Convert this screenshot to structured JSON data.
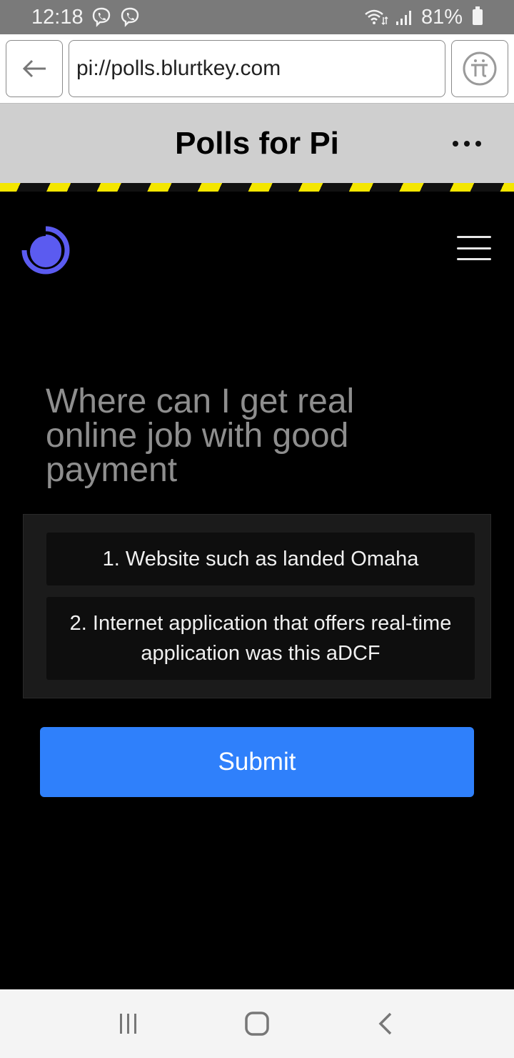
{
  "status_bar": {
    "time": "12:18",
    "battery": "81%",
    "icons": [
      "viber-icon",
      "viber-icon",
      "wifi-icon",
      "signal-icon",
      "battery-icon"
    ]
  },
  "browser": {
    "url": "pi://polls.blurtkey.com",
    "back_icon": "arrow-left-icon",
    "pi_icon": "pi-browser-icon"
  },
  "header": {
    "title": "Polls for Pi",
    "more_icon": "more-dots-icon"
  },
  "page": {
    "logo_icon": "pie-logo-icon",
    "menu_icon": "hamburger-menu-icon",
    "question": "Where can I get real online job with good payment",
    "options": [
      {
        "label": "1. Website such as landed Omaha"
      },
      {
        "label": "2. Internet application that offers real-time application was this aDCF"
      }
    ],
    "submit_label": "Submit"
  },
  "colors": {
    "accent": "#2f80fb",
    "logo": "#5b5bf0",
    "hazard_yellow": "#f4e600"
  },
  "nav": {
    "items": [
      "recent-apps-icon",
      "home-icon",
      "back-icon"
    ]
  }
}
